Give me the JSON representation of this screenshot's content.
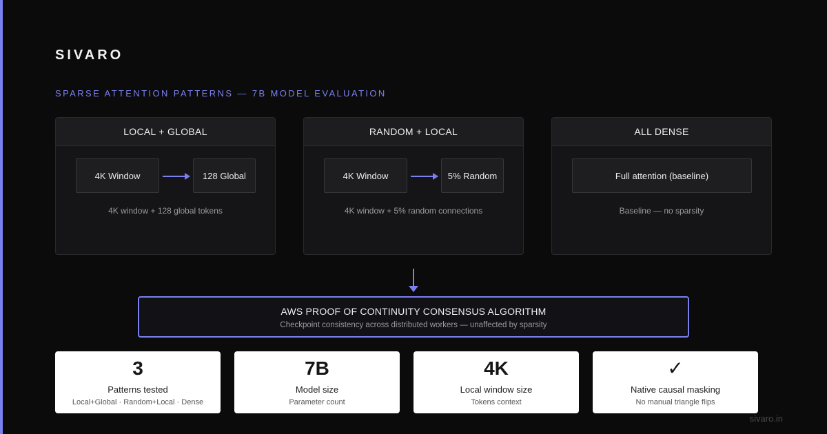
{
  "brand": "SIVARO",
  "subtitle": "SPARSE ATTENTION PATTERNS — 7B MODEL EVALUATION",
  "panels": [
    {
      "title": "LOCAL + GLOBAL",
      "nodes": [
        "4K Window",
        "128 Global"
      ],
      "caption": "4K window + 128 global tokens"
    },
    {
      "title": "RANDOM + LOCAL",
      "nodes": [
        "4K Window",
        "5% Random"
      ],
      "caption": "4K window + 5% random connections"
    },
    {
      "title": "ALL DENSE",
      "nodes": [
        "Full attention (baseline)"
      ],
      "caption": "Baseline — no sparsity"
    }
  ],
  "consensus": {
    "title": "AWS PROOF OF CONTINUITY CONSENSUS ALGORITHM",
    "subtitle": "Checkpoint consistency across distributed workers — unaffected by sparsity"
  },
  "stats": [
    {
      "value": "3",
      "label": "Patterns tested",
      "detail": "Local+Global · Random+Local · Dense"
    },
    {
      "value": "7B",
      "label": "Model size",
      "detail": "Parameter count"
    },
    {
      "value": "4K",
      "label": "Local window size",
      "detail": "Tokens context"
    },
    {
      "value": "✓",
      "label": "Native causal masking",
      "detail": "No manual triangle flips"
    }
  ],
  "footer": {
    "url": "sivaro.in"
  },
  "colors": {
    "accent": "#7b80f0",
    "background": "#0b0b0c",
    "panel": "#151517"
  }
}
